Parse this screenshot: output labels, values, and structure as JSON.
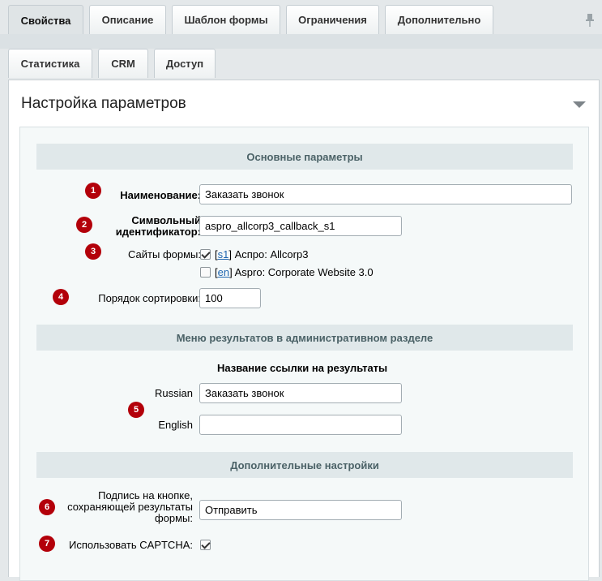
{
  "tabs_row1": [
    {
      "label": "Свойства",
      "active": true
    },
    {
      "label": "Описание",
      "active": false
    },
    {
      "label": "Шаблон формы",
      "active": false
    },
    {
      "label": "Ограничения",
      "active": false
    },
    {
      "label": "Дополнительно",
      "active": false
    }
  ],
  "tabs_row2": [
    {
      "label": "Статистика"
    },
    {
      "label": "CRM"
    },
    {
      "label": "Доступ"
    }
  ],
  "panel": {
    "title": "Настройка параметров"
  },
  "sections": {
    "main": "Основные параметры",
    "menu": "Меню результатов в административном разделе",
    "extra": "Дополнительные настройки"
  },
  "badges": [
    "1",
    "2",
    "3",
    "4",
    "5",
    "6",
    "7"
  ],
  "fields": {
    "name": {
      "label": "Наименование:",
      "value": "Заказать звонок"
    },
    "sid": {
      "label_line1": "Символьный",
      "label_line2": "идентификатор:",
      "value": "aspro_allcorp3_callback_s1"
    },
    "sites": {
      "label": "Сайты формы:",
      "items": [
        {
          "code": "s1",
          "name": "Аспро: Allcorp3",
          "checked": true
        },
        {
          "code": "en",
          "name": "Aspro: Corporate Website 3.0",
          "checked": false
        }
      ]
    },
    "sort": {
      "label": "Порядок сортировки:",
      "value": "100"
    },
    "results_link": {
      "heading": "Название ссылки на результаты",
      "russian_label": "Russian",
      "russian_value": "Заказать звонок",
      "english_label": "English",
      "english_value": ""
    },
    "button_caption": {
      "label_line1": "Подпись на кнопке,",
      "label_line2": "сохраняющей результаты",
      "label_line3": "формы:",
      "value": "Отправить"
    },
    "captcha": {
      "label": "Использовать CAPTCHA:",
      "checked": true
    }
  }
}
